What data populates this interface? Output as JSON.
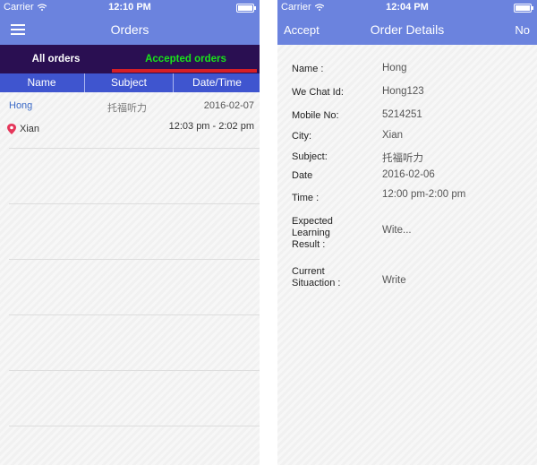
{
  "left": {
    "status": {
      "carrier": "Carrier",
      "time": "12:10 PM"
    },
    "title": "Orders",
    "tabs": [
      "All orders",
      "Accepted orders"
    ],
    "columns": [
      "Name",
      "Subject",
      "Date/Time"
    ],
    "orders": [
      {
        "name": "Hong",
        "subject": "托福听力",
        "date": "2016-02-07",
        "city": "Xian",
        "time": "12:03 pm - 2:02 pm"
      }
    ]
  },
  "right": {
    "status": {
      "carrier": "Carrier",
      "time": "12:04 PM"
    },
    "title": "Order Details",
    "accept": "Accept",
    "no": "No",
    "fields": [
      {
        "label": "Name :",
        "value": "Hong"
      },
      {
        "label": "We Chat Id:",
        "value": "Hong123"
      },
      {
        "label": "Mobile No:",
        "value": "5214251"
      },
      {
        "label": "City:",
        "value": "Xian"
      },
      {
        "label": "Subject:",
        "value": "托福听力"
      },
      {
        "label": "Date",
        "value": "2016-02-06"
      },
      {
        "label": "Time :",
        "value": "12:00 pm-2:00 pm"
      },
      {
        "label": "Expected\nLearning\nResult :",
        "value": "Wite..."
      },
      {
        "label": "Current\nSituaction :",
        "value": "Write"
      }
    ]
  },
  "colors": {
    "navbar": "#6b83de",
    "tabbar": "#2a0f52",
    "active_tab": "#19e319",
    "underline": "#d61f26",
    "header": "#3f55cf"
  },
  "icons": [
    "menu-icon",
    "wifi-icon",
    "battery-icon",
    "location-pin-icon"
  ]
}
